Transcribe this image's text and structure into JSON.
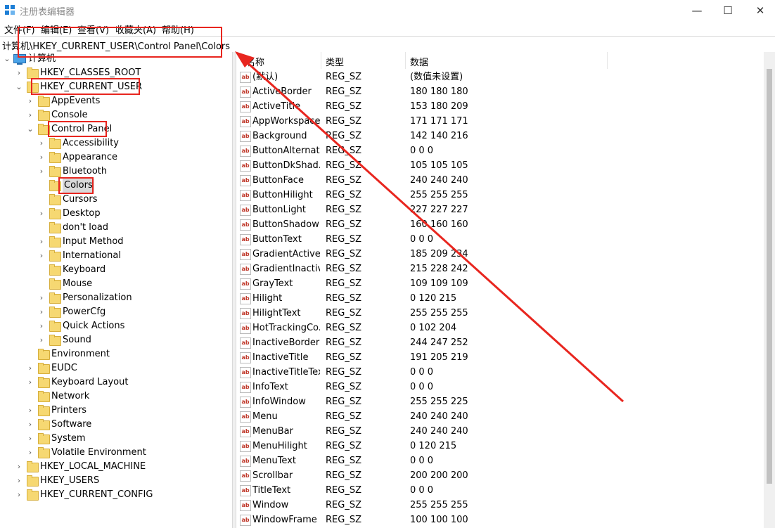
{
  "window": {
    "title": "注册表编辑器",
    "minimize_glyph": "—",
    "maximize_glyph": "☐",
    "close_glyph": "✕"
  },
  "menu": [
    "文件(F)",
    "编辑(E)",
    "查看(V)",
    "收藏夹(A)",
    "帮助(H)"
  ],
  "address": "计算机\\HKEY_CURRENT_USER\\Control Panel\\Colors",
  "tree": {
    "root": "计算机",
    "items": [
      {
        "label": "HKEY_CLASSES_ROOT",
        "level": 1,
        "expander": "›"
      },
      {
        "label": "HKEY_CURRENT_USER",
        "level": 1,
        "expander": "⌄"
      },
      {
        "label": "AppEvents",
        "level": 2,
        "expander": "›"
      },
      {
        "label": "Console",
        "level": 2,
        "expander": "›"
      },
      {
        "label": "Control Panel",
        "level": 2,
        "expander": "⌄"
      },
      {
        "label": "Accessibility",
        "level": 3,
        "expander": "›"
      },
      {
        "label": "Appearance",
        "level": 3,
        "expander": "›"
      },
      {
        "label": "Bluetooth",
        "level": 3,
        "expander": "›"
      },
      {
        "label": "Colors",
        "level": 3,
        "expander": "",
        "selected": true
      },
      {
        "label": "Cursors",
        "level": 3,
        "expander": ""
      },
      {
        "label": "Desktop",
        "level": 3,
        "expander": "›"
      },
      {
        "label": "don't load",
        "level": 3,
        "expander": ""
      },
      {
        "label": "Input Method",
        "level": 3,
        "expander": "›"
      },
      {
        "label": "International",
        "level": 3,
        "expander": "›"
      },
      {
        "label": "Keyboard",
        "level": 3,
        "expander": ""
      },
      {
        "label": "Mouse",
        "level": 3,
        "expander": ""
      },
      {
        "label": "Personalization",
        "level": 3,
        "expander": "›"
      },
      {
        "label": "PowerCfg",
        "level": 3,
        "expander": "›"
      },
      {
        "label": "Quick Actions",
        "level": 3,
        "expander": "›"
      },
      {
        "label": "Sound",
        "level": 3,
        "expander": "›"
      },
      {
        "label": "Environment",
        "level": 2,
        "expander": ""
      },
      {
        "label": "EUDC",
        "level": 2,
        "expander": "›"
      },
      {
        "label": "Keyboard Layout",
        "level": 2,
        "expander": "›"
      },
      {
        "label": "Network",
        "level": 2,
        "expander": ""
      },
      {
        "label": "Printers",
        "level": 2,
        "expander": "›"
      },
      {
        "label": "Software",
        "level": 2,
        "expander": "›"
      },
      {
        "label": "System",
        "level": 2,
        "expander": "›"
      },
      {
        "label": "Volatile Environment",
        "level": 2,
        "expander": "›"
      },
      {
        "label": "HKEY_LOCAL_MACHINE",
        "level": 1,
        "expander": "›"
      },
      {
        "label": "HKEY_USERS",
        "level": 1,
        "expander": "›"
      },
      {
        "label": "HKEY_CURRENT_CONFIG",
        "level": 1,
        "expander": "›"
      }
    ]
  },
  "list": {
    "columns": {
      "name": "名称",
      "type": "类型",
      "data": "数据"
    },
    "icon_text": "ab",
    "rows": [
      {
        "name": "(默认)",
        "type": "REG_SZ",
        "data": "(数值未设置)"
      },
      {
        "name": "ActiveBorder",
        "type": "REG_SZ",
        "data": "180 180 180"
      },
      {
        "name": "ActiveTitle",
        "type": "REG_SZ",
        "data": "153 180 209"
      },
      {
        "name": "AppWorkspace",
        "type": "REG_SZ",
        "data": "171 171 171"
      },
      {
        "name": "Background",
        "type": "REG_SZ",
        "data": "142 140 216"
      },
      {
        "name": "ButtonAlternat...",
        "type": "REG_SZ",
        "data": "0 0 0"
      },
      {
        "name": "ButtonDkShad...",
        "type": "REG_SZ",
        "data": "105 105 105"
      },
      {
        "name": "ButtonFace",
        "type": "REG_SZ",
        "data": "240 240 240"
      },
      {
        "name": "ButtonHilight",
        "type": "REG_SZ",
        "data": "255 255 255"
      },
      {
        "name": "ButtonLight",
        "type": "REG_SZ",
        "data": "227 227 227"
      },
      {
        "name": "ButtonShadow",
        "type": "REG_SZ",
        "data": "160 160 160"
      },
      {
        "name": "ButtonText",
        "type": "REG_SZ",
        "data": "0 0 0"
      },
      {
        "name": "GradientActive...",
        "type": "REG_SZ",
        "data": "185 209 234"
      },
      {
        "name": "GradientInactiv...",
        "type": "REG_SZ",
        "data": "215 228 242"
      },
      {
        "name": "GrayText",
        "type": "REG_SZ",
        "data": "109 109 109"
      },
      {
        "name": "Hilight",
        "type": "REG_SZ",
        "data": "0 120 215"
      },
      {
        "name": "HilightText",
        "type": "REG_SZ",
        "data": "255 255 255"
      },
      {
        "name": "HotTrackingCo...",
        "type": "REG_SZ",
        "data": "0 102 204"
      },
      {
        "name": "InactiveBorder",
        "type": "REG_SZ",
        "data": "244 247 252"
      },
      {
        "name": "InactiveTitle",
        "type": "REG_SZ",
        "data": "191 205 219"
      },
      {
        "name": "InactiveTitleText",
        "type": "REG_SZ",
        "data": "0 0 0"
      },
      {
        "name": "InfoText",
        "type": "REG_SZ",
        "data": "0 0 0"
      },
      {
        "name": "InfoWindow",
        "type": "REG_SZ",
        "data": "255 255 225"
      },
      {
        "name": "Menu",
        "type": "REG_SZ",
        "data": "240 240 240"
      },
      {
        "name": "MenuBar",
        "type": "REG_SZ",
        "data": "240 240 240"
      },
      {
        "name": "MenuHilight",
        "type": "REG_SZ",
        "data": "0 120 215"
      },
      {
        "name": "MenuText",
        "type": "REG_SZ",
        "data": "0 0 0"
      },
      {
        "name": "Scrollbar",
        "type": "REG_SZ",
        "data": "200 200 200"
      },
      {
        "name": "TitleText",
        "type": "REG_SZ",
        "data": "0 0 0"
      },
      {
        "name": "Window",
        "type": "REG_SZ",
        "data": "255 255 255"
      },
      {
        "name": "WindowFrame",
        "type": "REG_SZ",
        "data": "100 100 100"
      }
    ]
  },
  "colors": {
    "annotation": "#e8261f",
    "selection": "#d9d9d9",
    "folder": "#f6d872"
  }
}
